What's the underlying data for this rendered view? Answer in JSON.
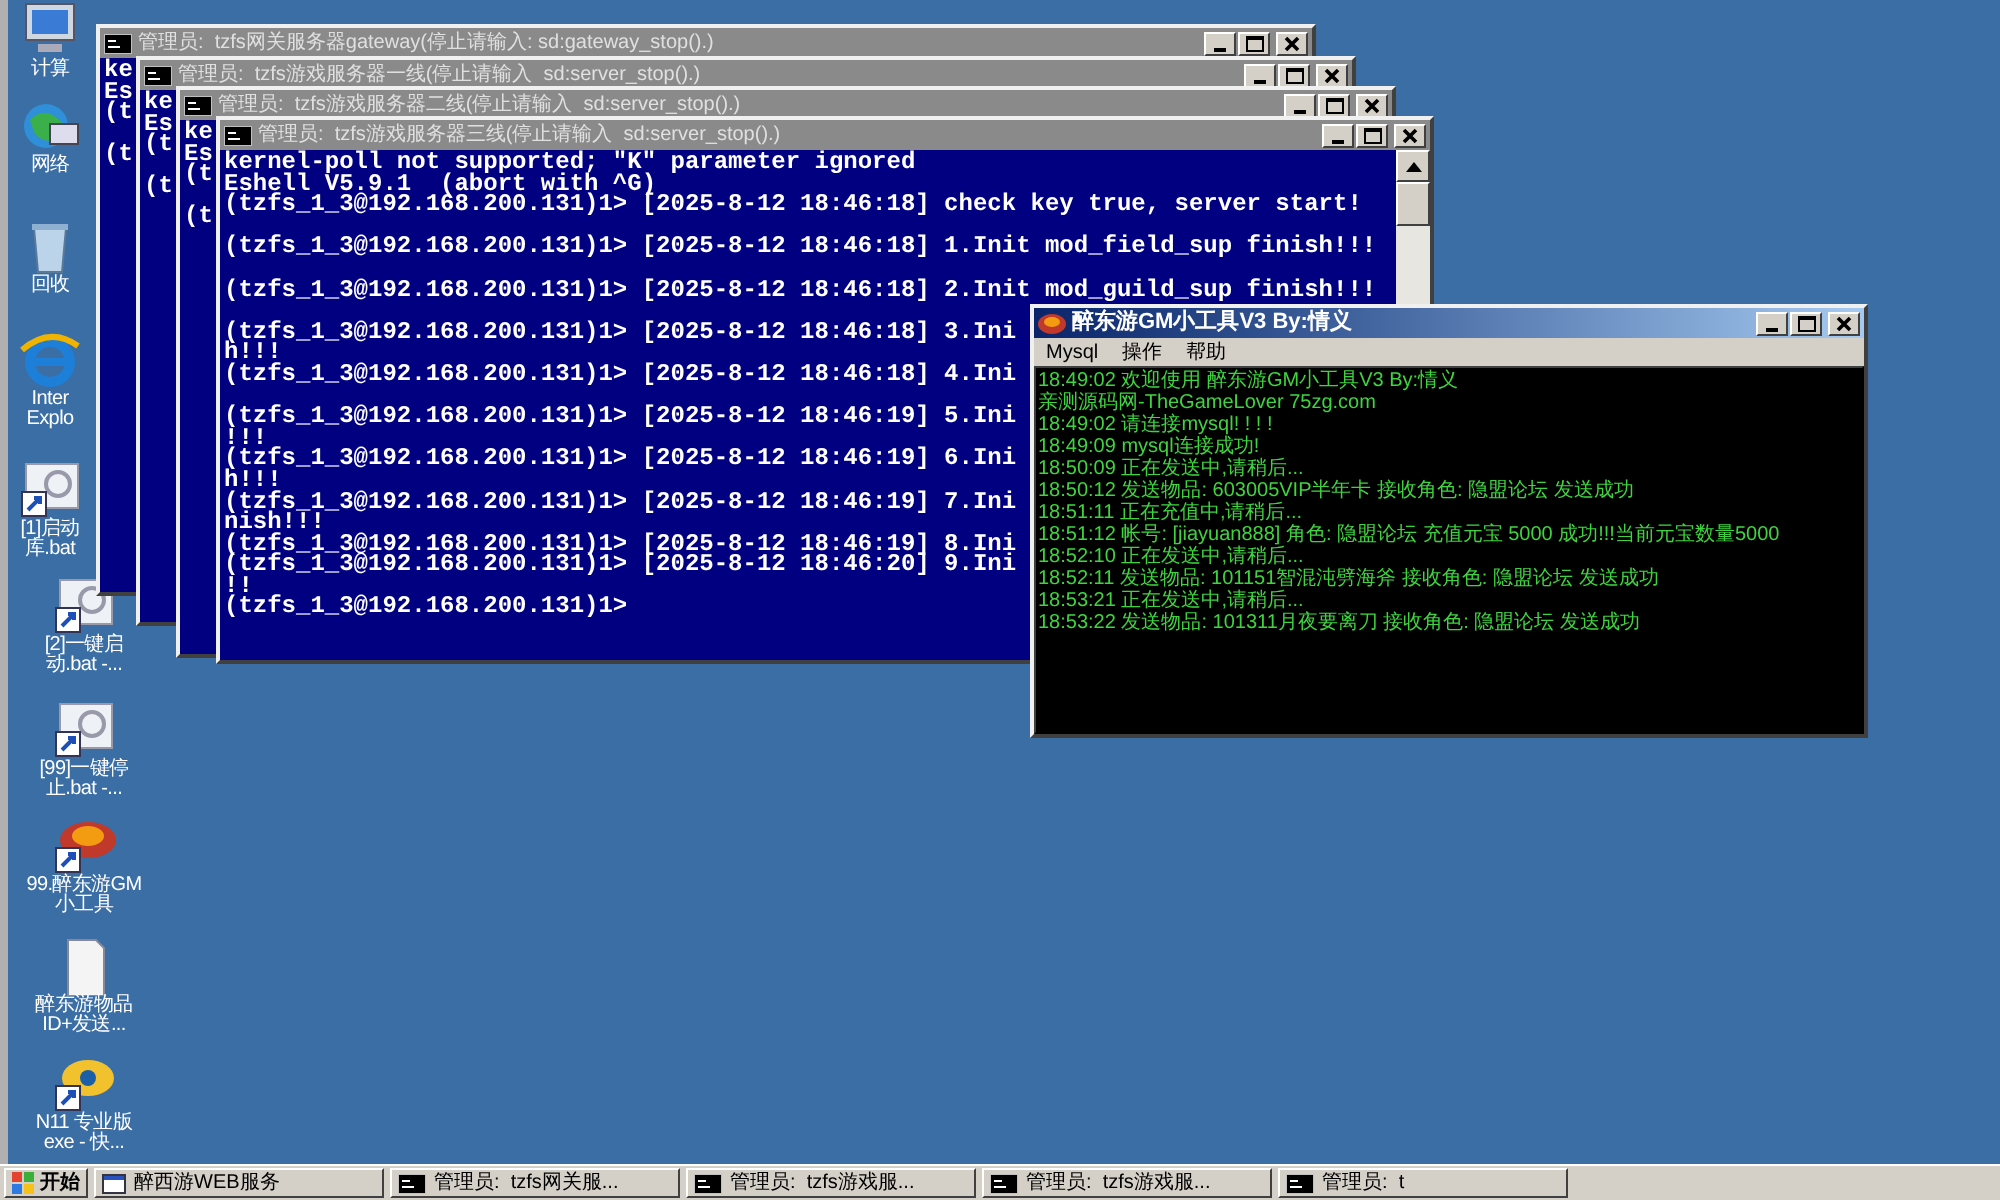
{
  "desktop_icons": [
    {
      "kind": "computer",
      "lines": [
        "计算"
      ]
    },
    {
      "kind": "network",
      "lines": [
        "网络"
      ]
    },
    {
      "kind": "recycle",
      "lines": [
        "回收"
      ]
    },
    {
      "kind": "browser",
      "lines": [
        "Inter",
        "Explo"
      ]
    },
    {
      "kind": "script",
      "lines": [
        "[1]启动",
        "库.bat"
      ]
    },
    {
      "kind": "script",
      "lines": [
        "[2]一键启",
        "动.bat -..."
      ]
    },
    {
      "kind": "script",
      "lines": [
        "[99]一键停",
        "止.bat -..."
      ]
    },
    {
      "kind": "game",
      "lines": [
        "99.醉东游GM",
        "小工具"
      ]
    },
    {
      "kind": "document",
      "lines": [
        "醉东游物品",
        "ID+发送..."
      ]
    },
    {
      "kind": "app",
      "lines": [
        "N11 专业版",
        "exe - 快..."
      ]
    }
  ],
  "console_windows": [
    {
      "title": "管理员:  tzfs网关服务器gateway(停止请输入: sd:gateway_stop().)",
      "lines": [
        {
          "text": "ke"
        },
        {
          "text": "Es"
        },
        {
          "text": "(t",
          "blank_after": true
        },
        {
          "text": "(t"
        }
      ]
    },
    {
      "title": "管理员:  tzfs游戏服务器一线(停止请输入  sd:server_stop().)",
      "lines": [
        {
          "text": "ke"
        },
        {
          "text": "Es"
        },
        {
          "text": "(t",
          "blank_after": true
        },
        {
          "text": "(t"
        }
      ]
    },
    {
      "title": "管理员:  tzfs游戏服务器二线(停止请输入  sd:server_stop().)",
      "lines": [
        {
          "text": "ke"
        },
        {
          "text": "Es"
        },
        {
          "text": "(t",
          "blank_after": true
        },
        {
          "text": "(t"
        }
      ]
    },
    {
      "title": "管理员:  tzfs游戏服务器三线(停止请输入  sd:server_stop().)",
      "lines": [
        {
          "text": "kernel-poll not supported; \"K\" parameter ignored"
        },
        {
          "text": "Eshell V5.9.1  (abort with ^G)"
        },
        {
          "text": "(tzfs_1_3@192.168.200.131)1> [2025-8-12 18:46:18] check key true, server start!",
          "blank_after": true
        },
        {
          "text": "(tzfs_1_3@192.168.200.131)1> [2025-8-12 18:46:18] 1.Init mod_field_sup finish!!!",
          "blank_after": true
        },
        {
          "text": "(tzfs_1_3@192.168.200.131)1> [2025-8-12 18:46:18] 2.Init mod_guild_sup finish!!!",
          "blank_after": true
        },
        {
          "text": "(tzfs_1_3@192.168.200.131)1> [2025-8-12 18:46:18] 3.Ini"
        },
        {
          "text": "h!!!"
        },
        {
          "text": "(tzfs_1_3@192.168.200.131)1> [2025-8-12 18:46:18] 4.Ini",
          "blank_after": true
        },
        {
          "text": "(tzfs_1_3@192.168.200.131)1> [2025-8-12 18:46:19] 5.Ini"
        },
        {
          "text": "!!!"
        },
        {
          "text": "(tzfs_1_3@192.168.200.131)1> [2025-8-12 18:46:19] 6.Ini"
        },
        {
          "text": "h!!!"
        },
        {
          "text": "(tzfs_1_3@192.168.200.131)1> [2025-8-12 18:46:19] 7.Ini"
        },
        {
          "text": "nish!!!"
        },
        {
          "text": "(tzfs_1_3@192.168.200.131)1> [2025-8-12 18:46:19] 8.Ini"
        },
        {
          "text": "(tzfs_1_3@192.168.200.131)1> [2025-8-12 18:46:20] 9.Ini"
        },
        {
          "text": "!!"
        },
        {
          "text": "(tzfs_1_3@192.168.200.131)1>"
        }
      ]
    }
  ],
  "gm_tool": {
    "title": "醉东游GM小工具V3 By:情义",
    "menu": [
      "Mysql",
      "操作",
      "帮助"
    ],
    "log": [
      "18:49:02 欢迎使用 醉东游GM小工具V3 By:情义",
      "亲测源码网-TheGameLover  75zg.com",
      "18:49:02 请连接mysql! ! ! !",
      "18:49:09 mysql连接成功!",
      "18:50:09 正在发送中,请稍后...",
      "18:50:12 发送物品: 603005VIP半年卡 接收角色: 隐盟论坛    发送成功",
      "18:51:11 正在充值中,请稍后...",
      "18:51:12 帐号: [jiayuan888] 角色: 隐盟论坛 充值元宝 5000 成功!!!当前元宝数量5000",
      "18:52:10 正在发送中,请稍后...",
      "18:52:11 发送物品: 101151智混沌劈海斧 接收角色: 隐盟论坛    发送成功",
      "18:53:21 正在发送中,请稍后...",
      "18:53:22 发送物品: 101311月夜要离刀 接收角色: 隐盟论坛    发送成功"
    ]
  },
  "taskbar": {
    "start": "开始",
    "buttons": [
      {
        "kind": "app",
        "label": "醉西游WEB服务"
      },
      {
        "kind": "console",
        "label": "管理员:  tzfs网关服..."
      },
      {
        "kind": "console",
        "label": "管理员:  tzfs游戏服..."
      },
      {
        "kind": "console",
        "label": "管理员:  tzfs游戏服..."
      },
      {
        "kind": "console",
        "label": "管理员:  t"
      }
    ]
  }
}
